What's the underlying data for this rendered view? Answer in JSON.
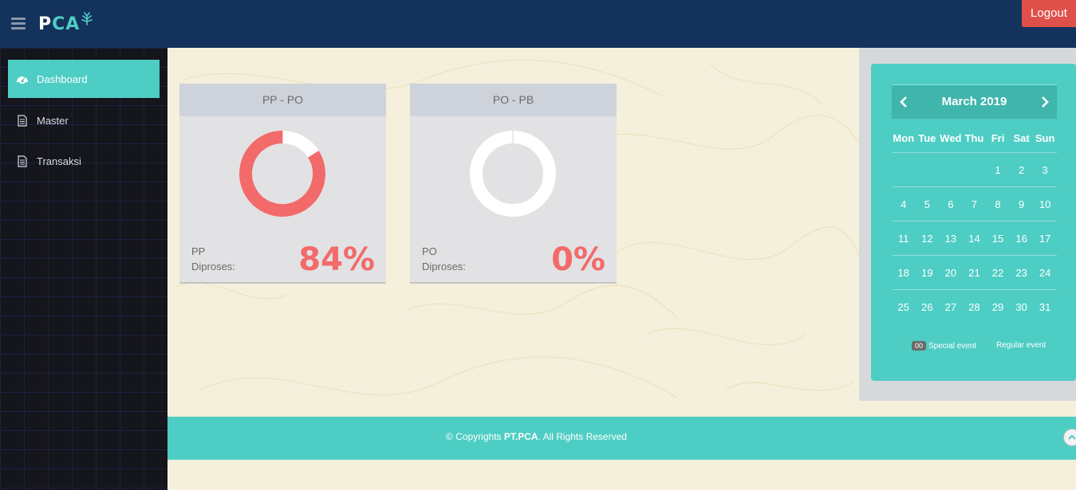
{
  "header": {
    "menu_icon": "hamburger-icon",
    "brand_p": "P",
    "brand_ca": "CA",
    "logout_label": "Logout",
    "colors": {
      "header_bg": "#14335c",
      "accent": "#4ecdc4",
      "logout": "#e0504a"
    }
  },
  "sidebar": {
    "items": [
      {
        "label": "Dashboard",
        "icon": "dashboard-icon",
        "active": true
      },
      {
        "label": "Master",
        "icon": "document-icon",
        "active": false
      },
      {
        "label": "Transaksi",
        "icon": "document-icon",
        "active": false
      }
    ]
  },
  "cards": [
    {
      "title": "PP - PO",
      "label_line1": "PP",
      "label_line2": "Diproses:",
      "percent_text": "84%",
      "percent_value": 84
    },
    {
      "title": "PO - PB",
      "label_line1": "PO",
      "label_line2": "Diproses:",
      "percent_text": "0%",
      "percent_value": 0
    }
  ],
  "calendar": {
    "month_label": "March 2019",
    "weekdays": [
      "Mon",
      "Tue",
      "Wed",
      "Thu",
      "Fri",
      "Sat",
      "Sun"
    ],
    "weeks": [
      [
        "",
        "",
        "",
        "",
        "1",
        "2",
        "3"
      ],
      [
        "4",
        "5",
        "6",
        "7",
        "8",
        "9",
        "10"
      ],
      [
        "11",
        "12",
        "13",
        "14",
        "15",
        "16",
        "17"
      ],
      [
        "18",
        "19",
        "20",
        "21",
        "22",
        "23",
        "24"
      ],
      [
        "25",
        "26",
        "27",
        "28",
        "29",
        "30",
        "31"
      ]
    ],
    "legend_badge": "00",
    "legend_special": "Special event",
    "legend_regular": "Regular event"
  },
  "footer": {
    "prefix": "© Copyrights ",
    "company": "PT.PCA",
    "suffix": ". All Rights Reserved"
  }
}
